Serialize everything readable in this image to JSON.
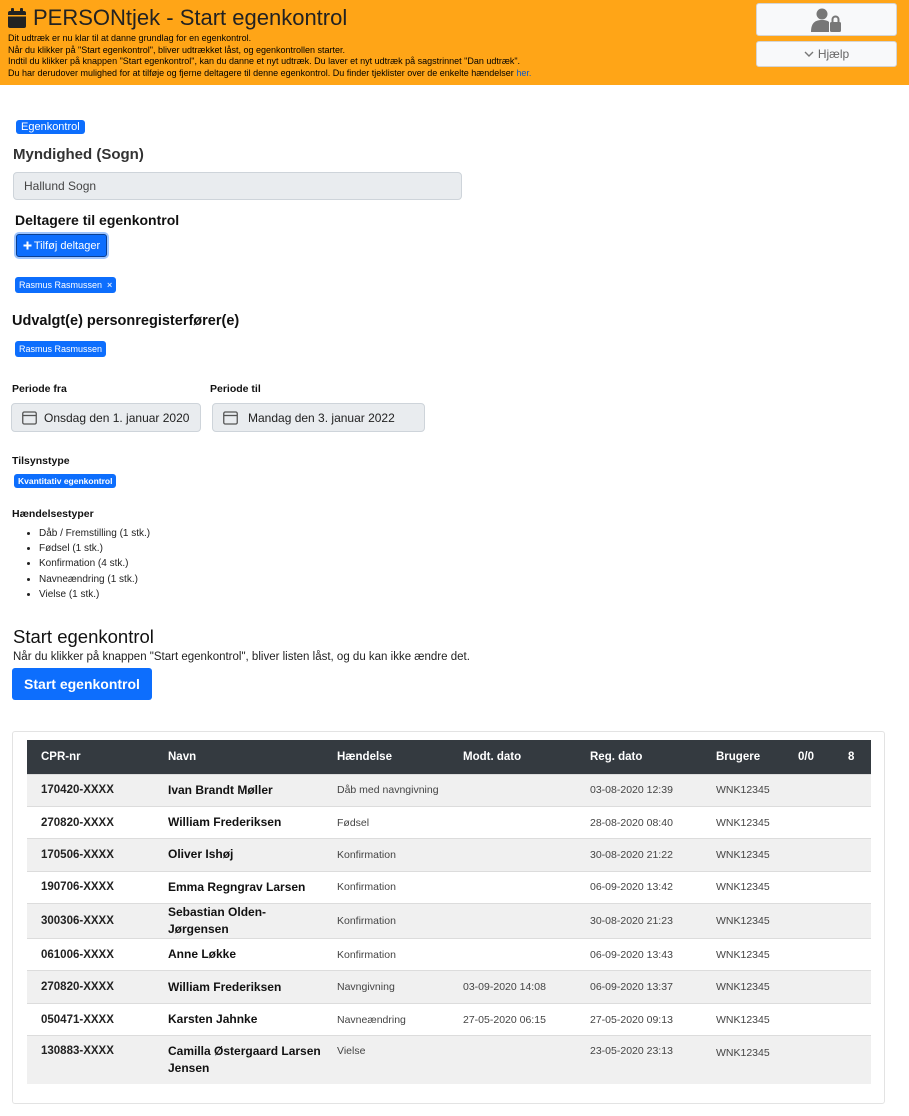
{
  "header": {
    "title": "PERSONtjek - Start egenkontrol",
    "lines": [
      "Dit udtræk er nu klar til at danne grundlag for en egenkontrol.",
      "Når du klikker på \"Start egenkontrol\", bliver udtrækket låst, og egenkontrollen starter.",
      "Indtil du klikker på knappen \"Start egenkontrol\", kan du danne et nyt udtræk. Du laver et nyt udtræk på sagstrinnet \"Dan udtræk\"."
    ],
    "last_line": "Du har derudover mulighed for at tilføje og fjerne deltagere til denne egenkontrol. Du finder tjeklister over de enkelte hændelser",
    "link_text": "her.",
    "help_label": "Hjælp"
  },
  "form": {
    "badge": "Egenkontrol",
    "authority_label": "Myndighed (Sogn)",
    "authority_value": "Hallund Sogn",
    "participants_label": "Deltagere til egenkontrol",
    "add_participant": "Tilføj deltager",
    "participant_chip": "Rasmus Rasmussen",
    "registrar_label": "Udvalgt(e) personregisterfører(e)",
    "registrar_chip": "Rasmus Rasmussen",
    "period_from_label": "Periode fra",
    "period_from_value": "Onsdag den 1. januar 2020",
    "period_to_label": "Periode til",
    "period_to_value": "Mandag den 3. januar 2022",
    "supervision_label": "Tilsynstype",
    "supervision_badge": "Kvantitativ egenkontrol",
    "event_types_label": "Hændelsestyper",
    "event_types": [
      "Dåb / Fremstilling (1 stk.)",
      "Fødsel (1 stk.)",
      "Konfirmation (4 stk.)",
      "Navneændring (1 stk.)",
      "Vielse (1 stk.)"
    ]
  },
  "start": {
    "heading": "Start egenkontrol",
    "description": "Når du klikker på knappen \"Start egenkontrol\", bliver listen låst, og du kan ikke ændre det.",
    "button_label": "Start egenkontrol"
  },
  "table": {
    "headers": [
      "CPR-nr",
      "Navn",
      "Hændelse",
      "Modt. dato",
      "Reg. dato",
      "Brugere",
      "0/0",
      "8"
    ],
    "rows": [
      {
        "cpr": "170420-XXXX",
        "name": "Ivan Brandt Møller",
        "event": "Dåb med navngivning",
        "received": "",
        "registered": "03-08-2020 12:39",
        "user": "WNK12345"
      },
      {
        "cpr": "270820-XXXX",
        "name": "William Frederiksen",
        "event": "Fødsel",
        "received": "",
        "registered": "28-08-2020 08:40",
        "user": "WNK12345"
      },
      {
        "cpr": "170506-XXXX",
        "name": "Oliver Ishøj",
        "event": "Konfirmation",
        "received": "",
        "registered": "30-08-2020 21:22",
        "user": "WNK12345"
      },
      {
        "cpr": "190706-XXXX",
        "name": "Emma Regngrav Larsen",
        "event": "Konfirmation",
        "received": "",
        "registered": "06-09-2020 13:42",
        "user": "WNK12345"
      },
      {
        "cpr": "300306-XXXX",
        "name": "Sebastian Olden-Jørgensen",
        "event": "Konfirmation",
        "received": "",
        "registered": "30-08-2020 21:23",
        "user": "WNK12345"
      },
      {
        "cpr": "061006-XXXX",
        "name": "Anne Løkke",
        "event": "Konfirmation",
        "received": "",
        "registered": "06-09-2020 13:43",
        "user": "WNK12345"
      },
      {
        "cpr": "270820-XXXX",
        "name": "William Frederiksen",
        "event": "Navngivning",
        "received": "03-09-2020 14:08",
        "registered": "06-09-2020 13:37",
        "user": "WNK12345"
      },
      {
        "cpr": "050471-XXXX",
        "name": "Karsten Jahnke",
        "event": "Navneændring",
        "received": "27-05-2020 06:15",
        "registered": "27-05-2020 09:13",
        "user": "WNK12345"
      },
      {
        "cpr": "130883-XXXX",
        "name": "Camilla Østergaard Larsen Jensen",
        "event": "Vielse",
        "received": "",
        "registered": "23-05-2020 23:13",
        "user": "WNK12345"
      }
    ]
  },
  "colors": {
    "header_bg": "#ffa517",
    "primary": "#0d6efd",
    "table_head": "#343a40"
  }
}
